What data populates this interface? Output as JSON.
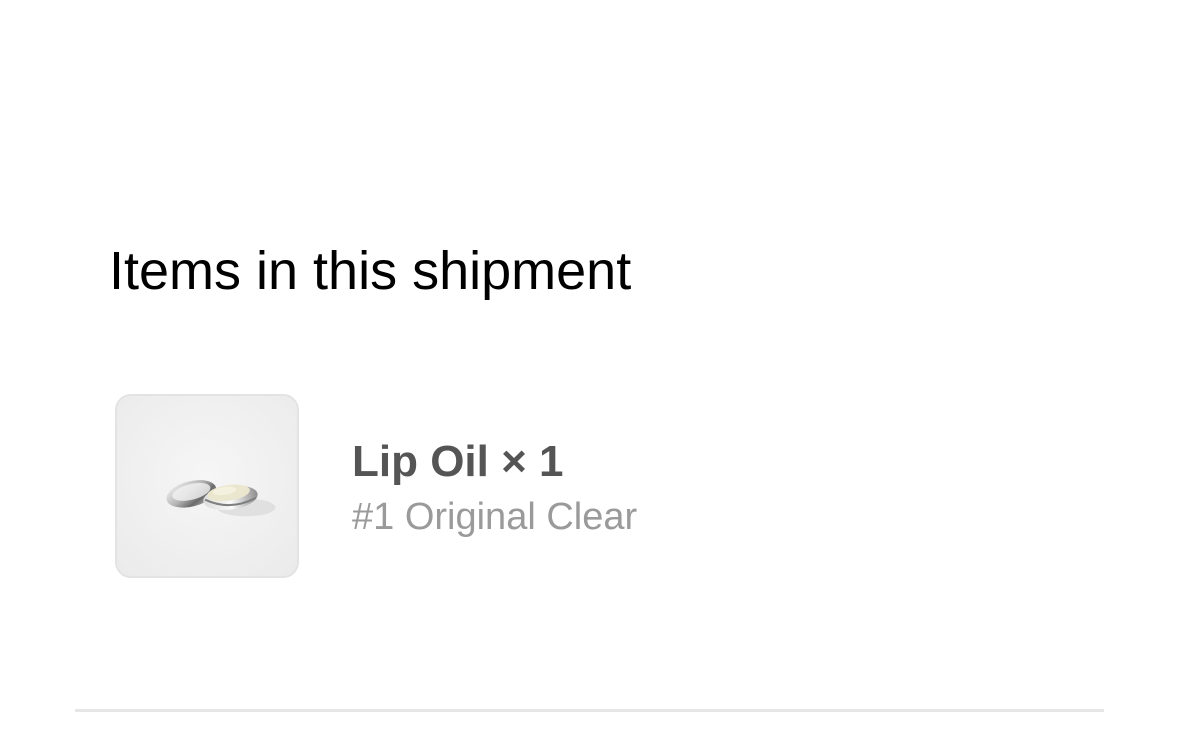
{
  "shipment": {
    "title": "Items in this shipment",
    "items": [
      {
        "name": "Lip Oil × 1",
        "variant": "#1 Original Clear",
        "image_icon": "lip-oil-product-image"
      }
    ]
  },
  "colors": {
    "title": "#000000",
    "item_name": "#555555",
    "item_variant": "#9a9a9a",
    "divider": "#e6e6e6",
    "thumbnail_background": "#efefef"
  }
}
